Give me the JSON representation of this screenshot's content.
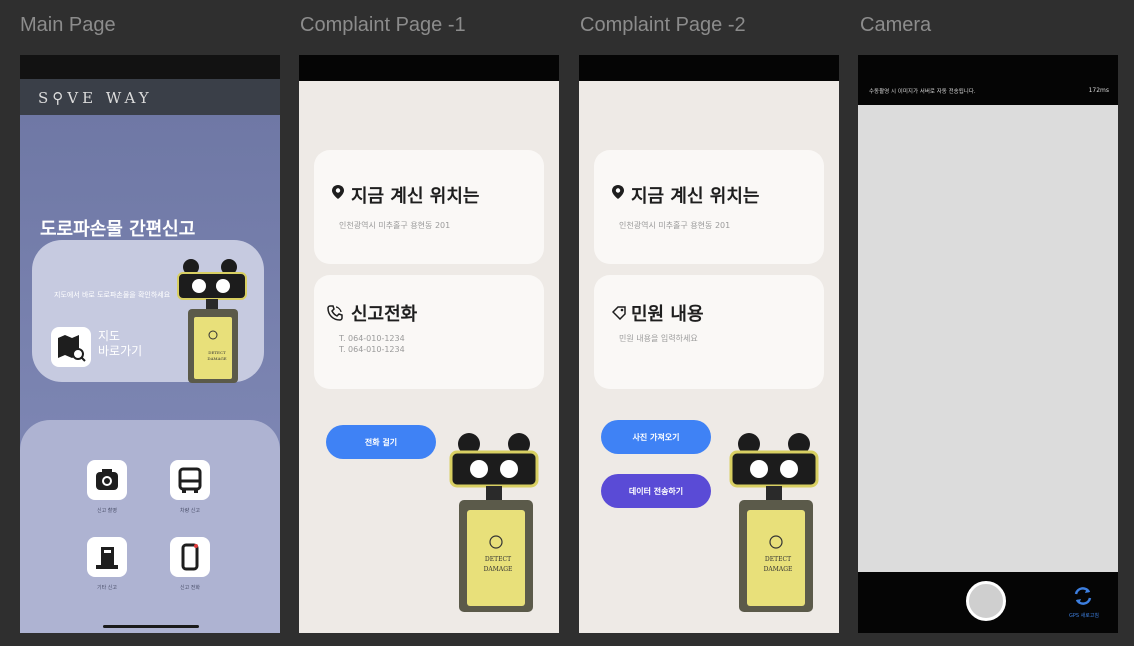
{
  "panels": {
    "main_title": "Main Page",
    "complaint1_title": "Complaint Page -1",
    "complaint2_title": "Complaint Page -2",
    "camera_title": "Camera"
  },
  "main": {
    "brand": "S⚲VE WAY",
    "hero_title": "도로파손물 간편신고",
    "map_desc": "지도에서 바로 도로파손물을 확인하세요",
    "map_label_line1": "지도",
    "map_label_line2": "바로가기",
    "menu": [
      {
        "label": "신고 촬영",
        "icon": "camera-icon"
      },
      {
        "label": "차량 신고",
        "icon": "bus-icon"
      },
      {
        "label": "기타 신고",
        "icon": "cone-icon"
      },
      {
        "label": "신고 전화",
        "icon": "phone-icon"
      }
    ],
    "robot_text_1": "DETECT",
    "robot_text_2": "DAMAGE"
  },
  "complaint1": {
    "location_title": "지금 계신 위치는",
    "location_value": "인천광역시 미추홀구 용현동 201",
    "phone_title": "신고전화",
    "phone_lines": [
      "T. 064-010-1234",
      "T. 064-010-1234"
    ],
    "call_button": "전화 걸기"
  },
  "complaint2": {
    "location_title": "지금 계신 위치는",
    "location_value": "인천광역시 미추홀구 용현동 201",
    "content_title": "민원 내용",
    "content_placeholder": "민원 내용을 입력하세요",
    "photo_button": "사진 가져오기",
    "send_button": "데이터 전송하기"
  },
  "camera": {
    "notice": "수동촬영 시 이미지가 서버로 자동 전송됩니다.",
    "fps": "172ms",
    "switch_label": "GPS 새로고침"
  },
  "colors": {
    "background": "#2f2f2f",
    "main_bg": "#6f78a5",
    "cream": "#eeeae6",
    "blue_button": "#3f82f5",
    "purple_button": "#5a4bd6",
    "robot_yellow": "#e8e07a"
  }
}
